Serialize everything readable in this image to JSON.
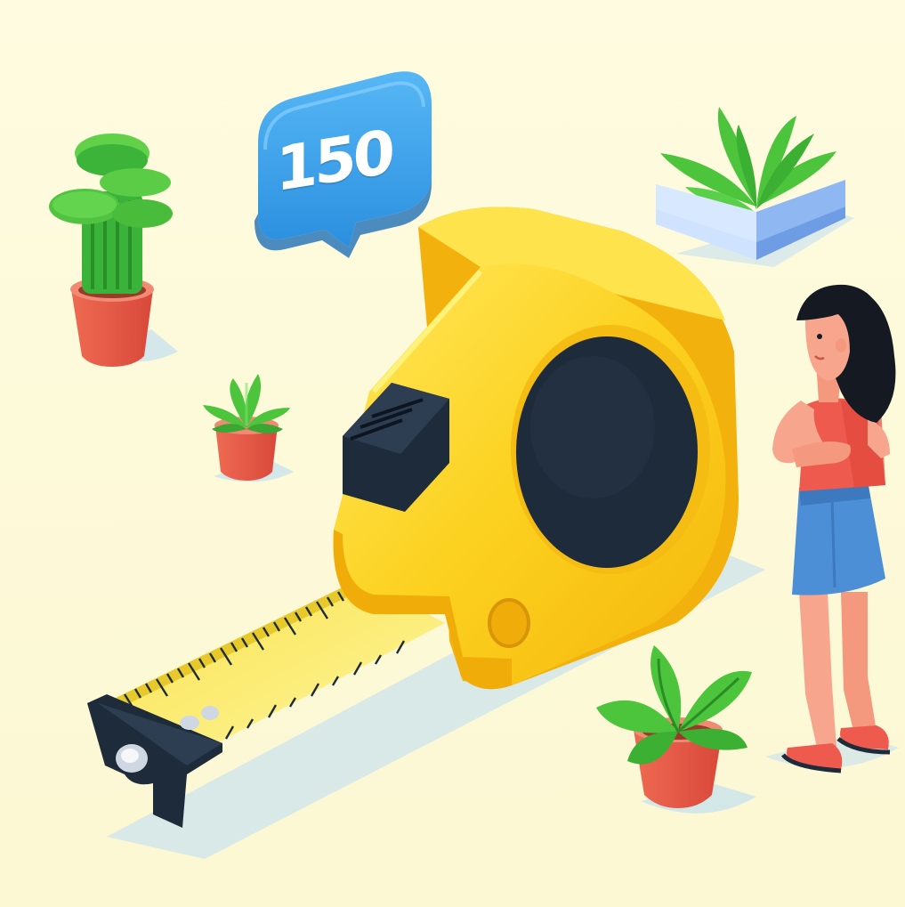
{
  "illustration": {
    "bubble_value": "150"
  },
  "colors": {
    "background": "#fcf8d3",
    "tape_body": "#fcd11f",
    "tape_dark": "#1e2b3a",
    "bubble": "#3aa0ea",
    "plant_green": "#4cc43c",
    "pot": "#e2553f",
    "shirt": "#ef5a4e",
    "skirt": "#4d8fd6",
    "hair": "#151a22"
  }
}
